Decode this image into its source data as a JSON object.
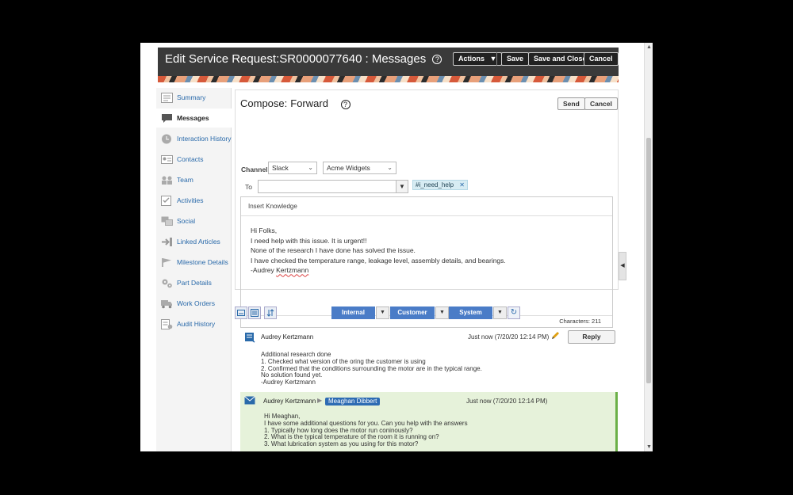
{
  "header": {
    "title": "Edit Service Request:SR0000077640",
    "subtitle": ": Messages",
    "help": "?",
    "actions_label": "Actions",
    "save_label": "Save",
    "save_close_label": "Save and Close",
    "cancel_label": "Cancel"
  },
  "sidebar": {
    "items": [
      {
        "label": "Summary",
        "icon": "summary-icon"
      },
      {
        "label": "Messages",
        "icon": "messages-icon",
        "active": true
      },
      {
        "label": "Interaction History",
        "icon": "clock-icon"
      },
      {
        "label": "Contacts",
        "icon": "contact-card-icon"
      },
      {
        "label": "Team",
        "icon": "team-icon"
      },
      {
        "label": "Activities",
        "icon": "activities-icon"
      },
      {
        "label": "Social",
        "icon": "social-icon"
      },
      {
        "label": "Linked Articles",
        "icon": "linked-articles-icon"
      },
      {
        "label": "Milestone Details",
        "icon": "milestone-flag-icon"
      },
      {
        "label": "Part Details",
        "icon": "gears-icon"
      },
      {
        "label": "Work Orders",
        "icon": "truck-icon"
      },
      {
        "label": "Audit History",
        "icon": "audit-icon"
      }
    ]
  },
  "compose": {
    "label": "Compose:",
    "mode": "Forward",
    "help": "?",
    "send_label": "Send",
    "cancel_label": "Cancel",
    "channel_label": "Channel",
    "channel_value": "Slack",
    "workspace_value": "Acme Widgets",
    "to_label": "To",
    "to_value": "",
    "recipient_tag": "#i_need_help",
    "insert_knowledge": "Insert Knowledge",
    "body_lines": [
      "Hi Folks,",
      "I need help with this issue. It is urgent!!",
      "None of the research I have done has solved the issue.",
      "I have checked the temperature range, leakage level, assembly details, and bearings."
    ],
    "signature_prefix": "-Audrey ",
    "signature_name": "Kertzmann",
    "characters": "Characters: 211"
  },
  "filters": {
    "internal": "Internal",
    "customer": "Customer",
    "system": "System"
  },
  "messages": [
    {
      "author": "Audrey Kertzmann",
      "time": "Just now (7/20/20 12:14 PM)",
      "reply_label": "Reply",
      "lines": [
        "Additional research done",
        "1. Checked what version of the oring the customer is using",
        "2. Confirmed that the conditions surrounding the motor are in the typical range.",
        "No solution found yet.",
        "-Audrey Kertzmann"
      ]
    },
    {
      "author": "Audrey Kertzmann",
      "recipient": "Meaghan Dibbert",
      "time": "Just now (7/20/20 12:14 PM)",
      "lines": [
        "Hi Meaghan,",
        "I have some additional questions for you. Can you help with the answers",
        "1. Typically how long does the motor run coninously?",
        "2. What is the typical temperature of the room it is running on?",
        "3. What lubrication system as you using for this motor?"
      ]
    }
  ],
  "colors": {
    "header_bg": "#3a3a3a",
    "link": "#2a6aaa",
    "filter_button": "#4a7cc7",
    "recipient_badge": "#2d6bb3",
    "outbound_bg": "#e6f2da",
    "outbound_border": "#6bb047"
  }
}
